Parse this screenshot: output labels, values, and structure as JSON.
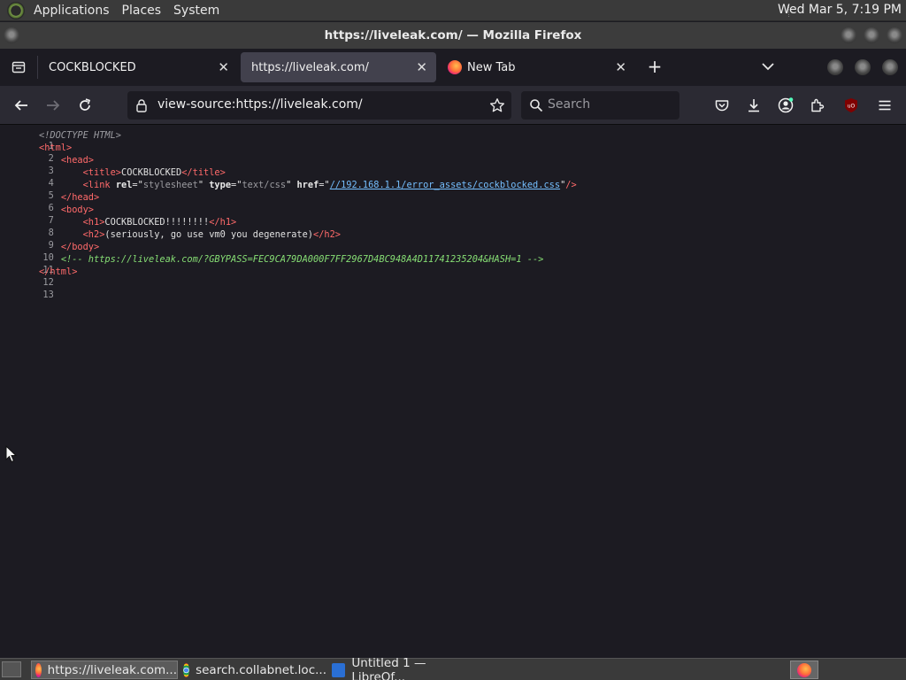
{
  "system_panel": {
    "menus": [
      "Applications",
      "Places",
      "System"
    ],
    "clock": "Wed Mar  5,  7:19 PM"
  },
  "window": {
    "title": "https://liveleak.com/ — Mozilla Firefox"
  },
  "tabs": [
    {
      "label": "COCKBLOCKED",
      "active": false,
      "favicon": "none"
    },
    {
      "label": "https://liveleak.com/",
      "active": true,
      "favicon": "none"
    },
    {
      "label": "New Tab",
      "active": false,
      "favicon": "firefox-icon"
    }
  ],
  "navbar": {
    "url": "view-source:https://liveleak.com/",
    "search_placeholder": "Search"
  },
  "source_lines": [
    {
      "n": "1"
    },
    {
      "n": "2"
    },
    {
      "n": "3"
    },
    {
      "n": "4"
    },
    {
      "n": "5"
    },
    {
      "n": "6"
    },
    {
      "n": "7"
    },
    {
      "n": "8"
    },
    {
      "n": "9"
    },
    {
      "n": "10"
    },
    {
      "n": "11"
    },
    {
      "n": "12"
    },
    {
      "n": "13"
    }
  ],
  "source": {
    "doctype": "<!DOCTYPE HTML>",
    "html_open": "<html>",
    "head_open": "<head>",
    "title_open": "<title>",
    "title_text": "COCKBLOCKED",
    "title_close": "</title>",
    "link_open": "<link",
    "attr_rel": "rel",
    "val_rel": "stylesheet",
    "attr_type": "type",
    "val_type": "text/css",
    "attr_href": "href",
    "val_href": "//192.168.1.1/error_assets/cockblocked.css",
    "link_close": "/>",
    "head_close": "</head>",
    "body_open": "<body>",
    "h1_open": "<h1>",
    "h1_text": "COCKBLOCKED!!!!!!!!",
    "h1_close": "</h1>",
    "h2_open": "<h2>",
    "h2_text": "(seriously, go use vm0 you degenerate)",
    "h2_close": "</h2>",
    "body_close": "</body>",
    "comment": "<!-- https://liveleak.com/?GBYPASS=FEC9CA79DA000F7FF2967D4BC948A4D11741235204&HASH=1 -->",
    "html_close": "</html>"
  },
  "taskbar": {
    "tasks": [
      {
        "label": "https://liveleak.com...",
        "icon": "firefox-icon",
        "active": true
      },
      {
        "label": "search.collabnet.loc...",
        "icon": "chrome-icon",
        "active": false
      },
      {
        "label": "Untitled 1 — LibreOf...",
        "icon": "libreoffice-writer-icon",
        "active": false
      }
    ]
  },
  "colors": {
    "tag": "#ff6a6a",
    "comment": "#86de74",
    "link": "#75bfff",
    "chrome_bg": "#2b2a33",
    "page_bg": "#1c1b22"
  }
}
